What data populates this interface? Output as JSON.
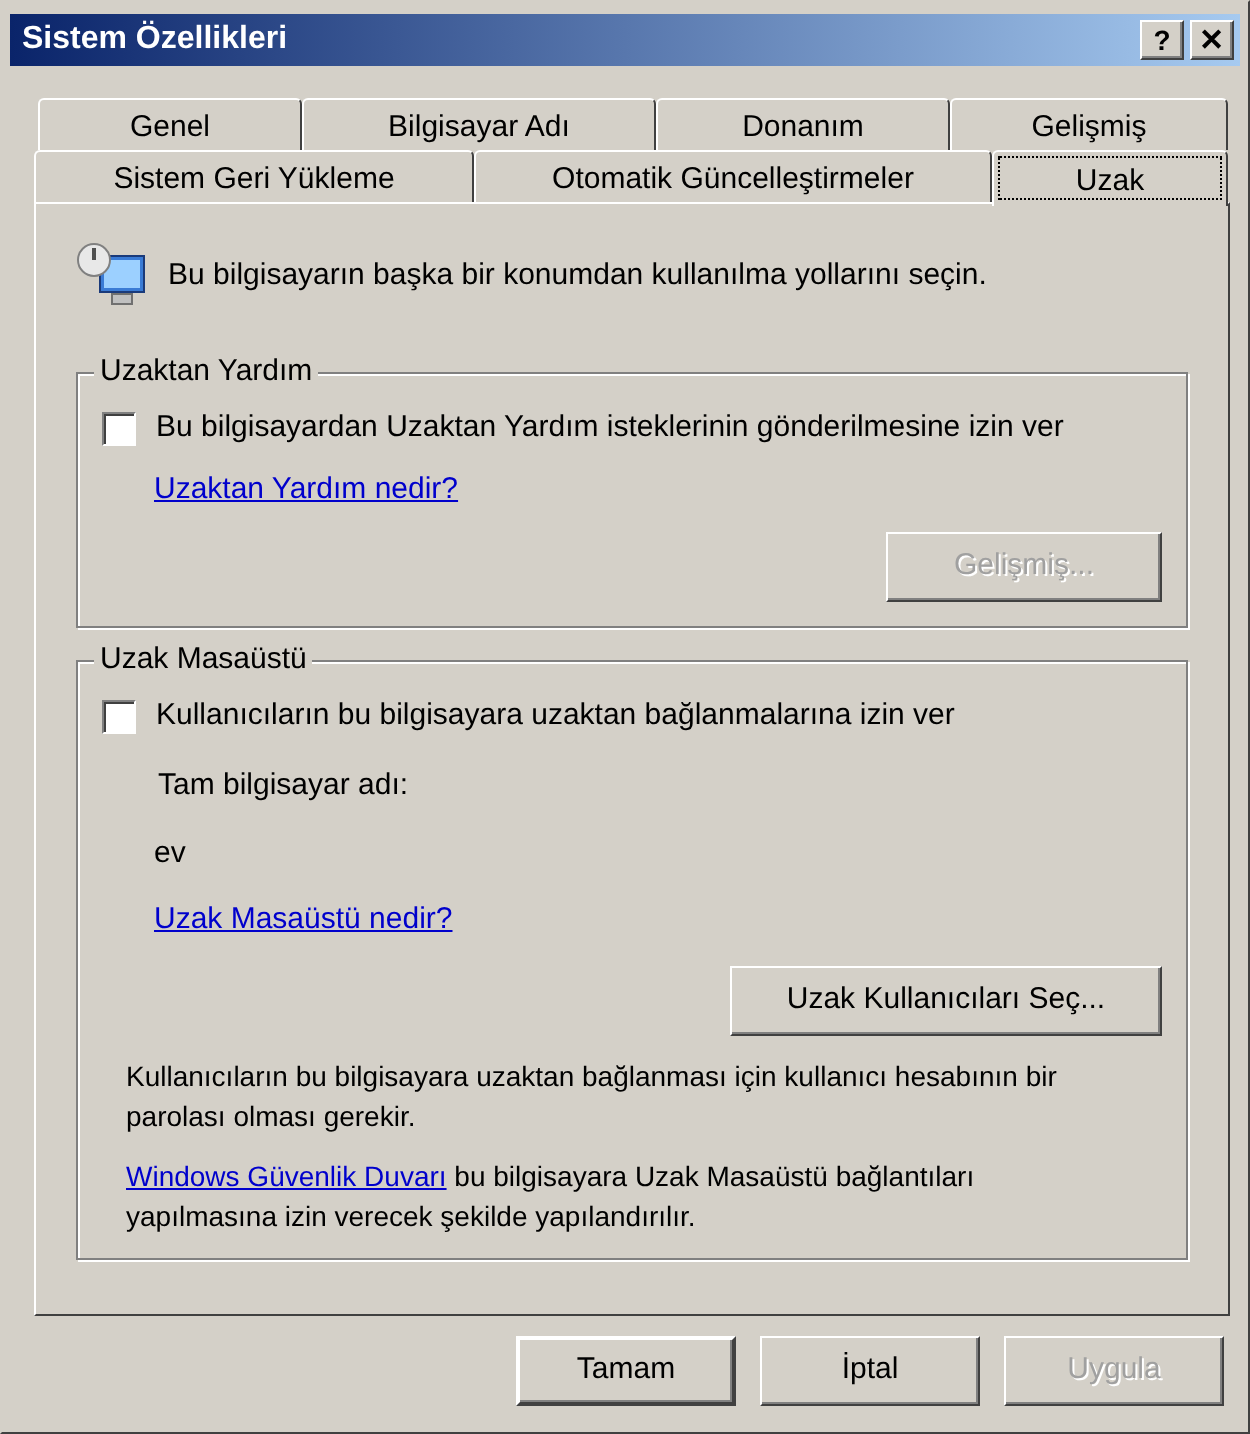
{
  "window": {
    "title": "Sistem Özellikleri",
    "title_buttons": [
      {
        "label": "?",
        "kind": "help"
      },
      {
        "label": "✕",
        "kind": "close"
      }
    ]
  },
  "tab_rows": [
    [
      {
        "label": "Genel",
        "selected": false
      },
      {
        "label": "Bilgisayar Adı",
        "selected": false
      },
      {
        "label": "Donanım",
        "selected": false
      },
      {
        "label": "Gelişmiş",
        "selected": false
      }
    ],
    [
      {
        "label": "Sistem Geri Yükleme",
        "selected": false
      },
      {
        "label": "Otomatik Güncelleştirmeler",
        "selected": false
      },
      {
        "label": "Uzak",
        "selected": true
      }
    ]
  ],
  "intro": "Bu bilgisayarın başka bir konumdan kullanılma yollarını seçin.",
  "remote_assistance": {
    "title": "Uzaktan Yardım",
    "checkbox": {
      "label": "Bu bilgisayardan Uzaktan Yardım isteklerinin gönderilmesine izin ver",
      "checked": false
    },
    "link": "Uzaktan Yardım nedir?",
    "button": {
      "label": "Gelişmiş...",
      "disabled": true
    }
  },
  "remote_desktop": {
    "title": "Uzak Masaüstü",
    "checkbox": {
      "label": "Kullanıcıların bu bilgisayara uzaktan bağlanmalarına izin ver",
      "checked": false
    },
    "computer_name_label": "Tam bilgisayar adı:",
    "computer_name": "ev",
    "link": "Uzak Masaüstü nedir?",
    "button": {
      "label": "Uzak Kullanıcıları Seç...",
      "disabled": false
    },
    "note": "Kullanıcıların bu bilgisayara uzaktan bağlanması için kullanıcı hesabının bir parolası olması gerekir.",
    "firewall_link": "Windows Güvenlik Duvarı",
    "firewall_text": "bu bilgisayara Uzak Masaüstü bağlantıları yapılmasına izin verecek şekilde yapılandırılır."
  },
  "buttons": [
    {
      "label": "Tamam",
      "default": true,
      "disabled": false
    },
    {
      "label": "İptal",
      "default": false,
      "disabled": false
    },
    {
      "label": "Uygula",
      "default": false,
      "disabled": true
    }
  ]
}
